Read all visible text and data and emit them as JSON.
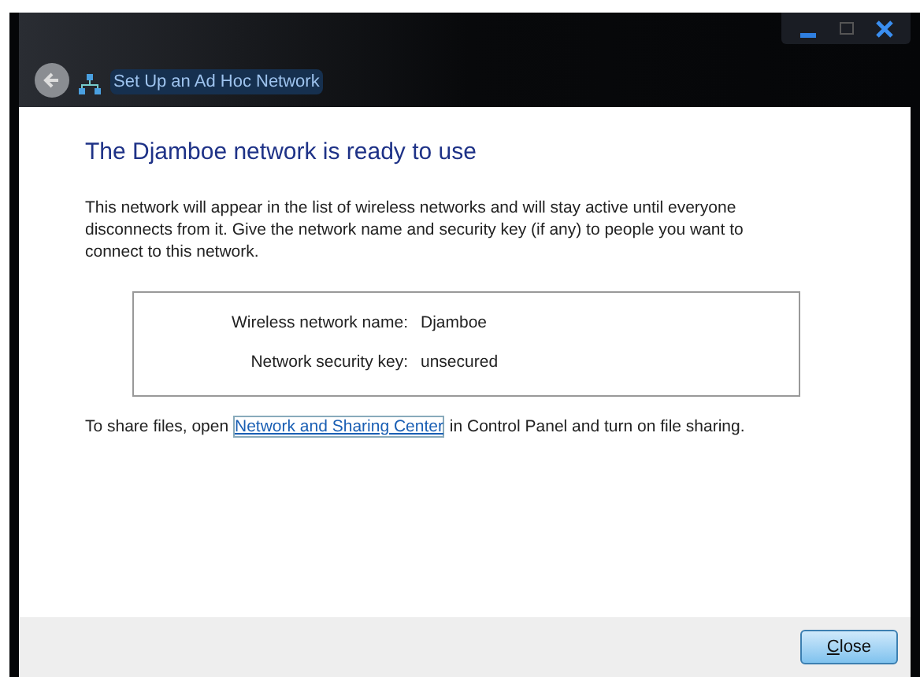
{
  "window": {
    "title": "Set Up an Ad Hoc Network"
  },
  "heading": "The Djamboe network is ready to use",
  "description": "This network will appear in the list of wireless networks and will stay active until everyone disconnects from it. Give the network name and security key (if any) to people you want to connect to this network.",
  "details": [
    {
      "label": "Wireless network name:",
      "value": "Djamboe"
    },
    {
      "label": "Network security key:",
      "value": "unsecured"
    }
  ],
  "share_note": {
    "before": "To share files, open ",
    "link": "Network and Sharing Center",
    "after": " in Control Panel and turn on file sharing."
  },
  "buttons": [
    {
      "label": "Close",
      "access_key_underlined": true
    }
  ]
}
